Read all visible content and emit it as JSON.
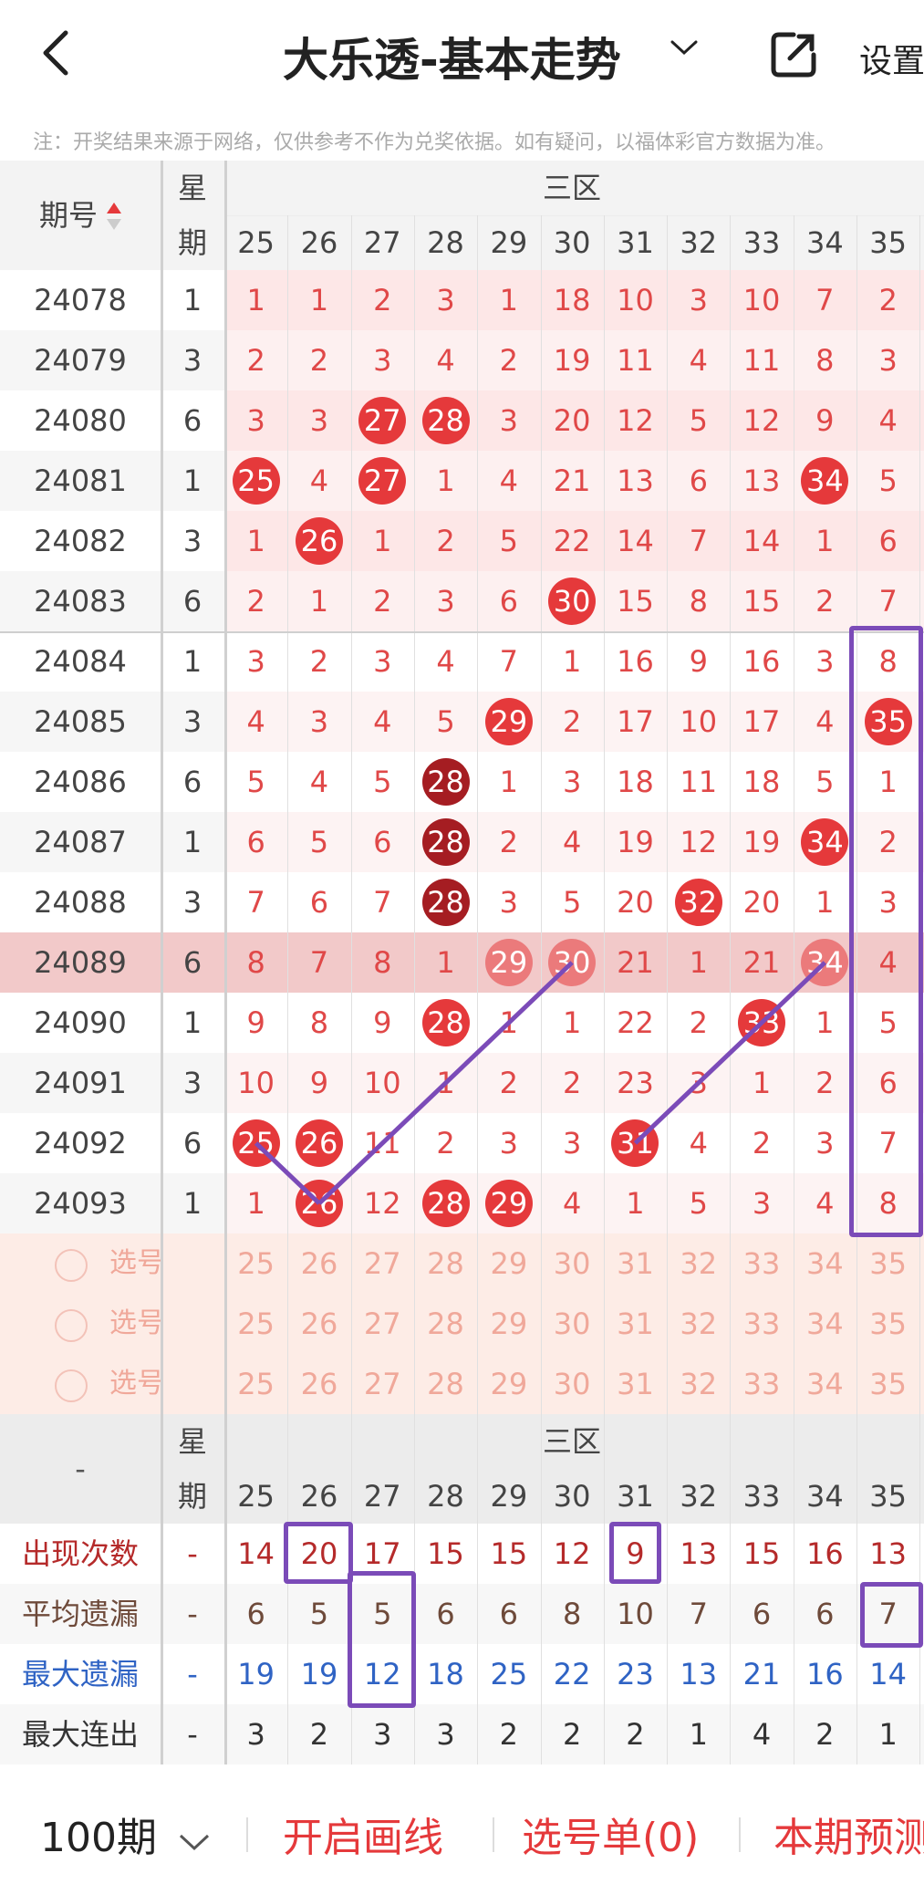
{
  "header": {
    "back_icon": "chevron-left-icon",
    "title": "大乐透-基本走势",
    "dropdown_icon": "chevron-down-icon",
    "share_icon": "share-external-icon",
    "settings_label": "设置"
  },
  "notice": "注：开奖结果来源于网络，仅供参考不作为兑奖依据。如有疑问，以福体彩官方数据为准。",
  "table": {
    "col_issue": "期号",
    "col_week_top": "星",
    "col_week_bottom": "期",
    "zone_label": "三区",
    "numbers": [
      "25",
      "26",
      "27",
      "28",
      "29",
      "30",
      "31",
      "32",
      "33",
      "34",
      "35"
    ],
    "rows": [
      {
        "issue": "24078",
        "week": "1",
        "cells": [
          "1",
          "1",
          "2",
          "3",
          "1",
          "18",
          "10",
          "3",
          "10",
          "7",
          "2"
        ]
      },
      {
        "issue": "24079",
        "week": "3",
        "cells": [
          "2",
          "2",
          "3",
          "4",
          "2",
          "19",
          "11",
          "4",
          "11",
          "8",
          "3"
        ]
      },
      {
        "issue": "24080",
        "week": "6",
        "cells": [
          "3",
          "3",
          "27",
          "28",
          "3",
          "20",
          "12",
          "5",
          "12",
          "9",
          "4"
        ]
      },
      {
        "issue": "24081",
        "week": "1",
        "cells": [
          "25",
          "4",
          "27",
          "1",
          "4",
          "21",
          "13",
          "6",
          "13",
          "34",
          "5"
        ]
      },
      {
        "issue": "24082",
        "week": "3",
        "cells": [
          "1",
          "26",
          "1",
          "2",
          "5",
          "22",
          "14",
          "7",
          "14",
          "1",
          "6"
        ]
      },
      {
        "issue": "24083",
        "week": "6",
        "cells": [
          "2",
          "1",
          "2",
          "3",
          "6",
          "30",
          "15",
          "8",
          "15",
          "2",
          "7"
        ]
      },
      {
        "issue": "24084",
        "week": "1",
        "cells": [
          "3",
          "2",
          "3",
          "4",
          "7",
          "1",
          "16",
          "9",
          "16",
          "3",
          "8"
        ]
      },
      {
        "issue": "24085",
        "week": "3",
        "cells": [
          "4",
          "3",
          "4",
          "5",
          "29",
          "2",
          "17",
          "10",
          "17",
          "4",
          "35"
        ]
      },
      {
        "issue": "24086",
        "week": "6",
        "cells": [
          "5",
          "4",
          "5",
          "28",
          "1",
          "3",
          "18",
          "11",
          "18",
          "5",
          "1"
        ]
      },
      {
        "issue": "24087",
        "week": "1",
        "cells": [
          "6",
          "5",
          "6",
          "28",
          "2",
          "4",
          "19",
          "12",
          "19",
          "34",
          "2"
        ]
      },
      {
        "issue": "24088",
        "week": "3",
        "cells": [
          "7",
          "6",
          "7",
          "28",
          "3",
          "5",
          "20",
          "32",
          "20",
          "1",
          "3"
        ]
      },
      {
        "issue": "24089",
        "week": "6",
        "cells": [
          "8",
          "7",
          "8",
          "1",
          "29",
          "30",
          "21",
          "1",
          "21",
          "34",
          "4"
        ]
      },
      {
        "issue": "24090",
        "week": "1",
        "cells": [
          "9",
          "8",
          "9",
          "28",
          "1",
          "1",
          "22",
          "2",
          "33",
          "1",
          "5"
        ]
      },
      {
        "issue": "24091",
        "week": "3",
        "cells": [
          "10",
          "9",
          "10",
          "1",
          "2",
          "2",
          "23",
          "3",
          "1",
          "2",
          "6"
        ]
      },
      {
        "issue": "24092",
        "week": "6",
        "cells": [
          "25",
          "26",
          "11",
          "2",
          "3",
          "3",
          "31",
          "4",
          "2",
          "3",
          "7"
        ]
      },
      {
        "issue": "24093",
        "week": "1",
        "cells": [
          "1",
          "26",
          "12",
          "28",
          "29",
          "4",
          "1",
          "5",
          "3",
          "4",
          "8"
        ]
      }
    ],
    "select_label": "选号",
    "stats": [
      {
        "label": "出现次数",
        "week": "-",
        "color": "#b52a2a",
        "values": [
          "14",
          "20",
          "17",
          "15",
          "15",
          "12",
          "9",
          "13",
          "15",
          "16",
          "13"
        ]
      },
      {
        "label": "平均遗漏",
        "week": "-",
        "color": "#6e4a3a",
        "values": [
          "6",
          "5",
          "5",
          "6",
          "6",
          "8",
          "10",
          "7",
          "6",
          "6",
          "7"
        ]
      },
      {
        "label": "最大遗漏",
        "week": "-",
        "color": "#2f63c4",
        "values": [
          "19",
          "19",
          "12",
          "18",
          "25",
          "22",
          "23",
          "13",
          "21",
          "16",
          "14"
        ]
      },
      {
        "label": "最大连出",
        "week": "-",
        "color": "#333333",
        "values": [
          "3",
          "2",
          "3",
          "3",
          "2",
          "2",
          "2",
          "1",
          "4",
          "2",
          "1"
        ]
      }
    ],
    "stats_corner": "-"
  },
  "footer": {
    "period": "100期",
    "draw_line": "开启画线",
    "selection": "选号单(0)",
    "forecast": "本期预测"
  },
  "colors": {
    "accent_red": "#e5393b",
    "dark_red": "#a51d22",
    "purple": "#7b4bb8"
  }
}
